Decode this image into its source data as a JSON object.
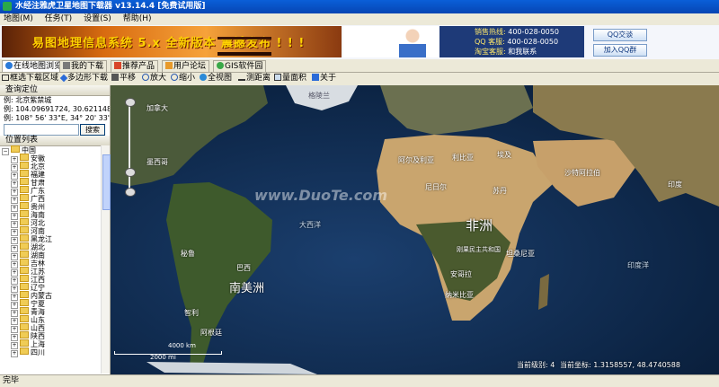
{
  "window": {
    "title": "水经注雅虎卫星地图下载器 v13.14.4 [免费试用版]"
  },
  "menu": [
    "地图(M)",
    "任务(T)",
    "设置(S)",
    "帮助(H)"
  ],
  "banner": {
    "ad_text": "易图地理信息系统 5.x 全新版本 震撼发布 ! ! !",
    "hotline": [
      {
        "label": "销售热线:",
        "value": "400-028-0050"
      },
      {
        "label": "QQ 客服:",
        "value": "400-028-0050"
      },
      {
        "label": "淘宝客服:",
        "value": "和我联系"
      }
    ],
    "qq_chat": "QQ交谈",
    "qq_add": "加入QQ群"
  },
  "tabs": [
    "在线地图浏览",
    "我的下载",
    "推荐产品",
    "用户论坛",
    "GIS软件园"
  ],
  "toolbar": [
    "框选下载区域",
    "多边形下载",
    "平移",
    "放大",
    "缩小",
    "全视图",
    "测距离",
    "量面积",
    "关于"
  ],
  "query": {
    "header": "查询定位",
    "examples": [
      "例: 北京紫禁城",
      "例: 104.09691724, 30.62114865",
      "例: 108° 56' 33\"E, 34° 20' 33\"N"
    ],
    "search_value": "",
    "search_button": "搜索"
  },
  "locations": {
    "header": "位置列表",
    "root": "中国",
    "items": [
      "安徽",
      "北京",
      "福建",
      "甘肃",
      "广东",
      "广西",
      "贵州",
      "海南",
      "河北",
      "河南",
      "黑龙江",
      "湖北",
      "湖南",
      "吉林",
      "江苏",
      "江西",
      "辽宁",
      "内蒙古",
      "宁夏",
      "青海",
      "山东",
      "山西",
      "陕西",
      "上海",
      "四川"
    ]
  },
  "map": {
    "labels": [
      "非洲",
      "南美洲",
      "大西洋",
      "巴西",
      "阿根廷",
      "秘鲁",
      "阿尔及利亚",
      "利比亚",
      "埃及",
      "尼日尔",
      "苏丹",
      "刚果民主共和国",
      "安哥拉",
      "纳米比亚",
      "加拿大",
      "格陵兰",
      "智利",
      "坦桑尼亚",
      "印度洋",
      "印度",
      "沙特阿拉伯",
      "墨西哥"
    ],
    "scale_km": "4000 km",
    "scale_mi": "2000 mi",
    "watermark": "www.DuoTe.com",
    "status_level": "当前级别: 4",
    "status_coord": "当前坐标: 1.3158557, 48.4740588"
  },
  "status": "完毕"
}
